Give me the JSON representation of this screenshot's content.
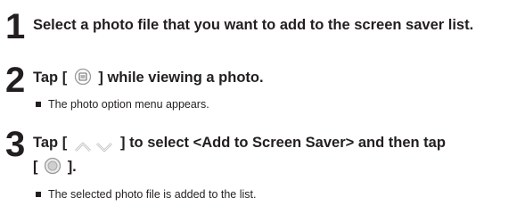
{
  "steps": [
    {
      "number": "1",
      "text": "Select a photo file that you want to add to the screen saver list."
    },
    {
      "number": "2",
      "text_before": "Tap [",
      "icon": "menu-icon",
      "text_after": "] while viewing a photo.",
      "note": "The photo option menu appears."
    },
    {
      "number": "3",
      "line1_before": "Tap [",
      "icons": [
        "up-arrow-icon",
        "down-arrow-icon"
      ],
      "line1_after": "] to select <Add to Screen Saver> and then tap",
      "line2_before": "[",
      "line2_icon": "select-button-icon",
      "line2_after": "].",
      "note": "The selected photo file is added to the list."
    }
  ]
}
